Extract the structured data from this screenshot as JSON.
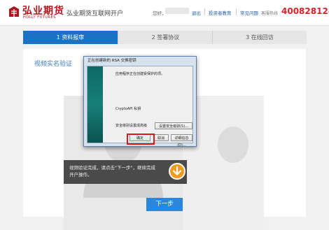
{
  "header": {
    "logo_cn": "弘业期货",
    "logo_en": "HOLLY FUTURES",
    "site_title": "弘业期货互联网开户",
    "greeting": "您好，",
    "logout": "退出",
    "links": [
      "投资者教育",
      "常见问题"
    ],
    "hotline_label": "客服热线",
    "hotline": "4008281288"
  },
  "steps": [
    {
      "label": "1 资料报审",
      "active": true
    },
    {
      "label": "2 签署协议",
      "active": false
    },
    {
      "label": "3 在线回访",
      "active": false
    }
  ],
  "panel": {
    "section_title": "视频实名验证",
    "video_hint": "视频验证完成，请点击\"下一步\"，继续完成开户操作。",
    "next_button": "下一步"
  },
  "dialog": {
    "title": "正在创建新的 RSA 交换密钥",
    "message": "应用程序正在创建受保护的项。",
    "key_name": "CryptoAPI 私钥",
    "security_level_label": "安全级别设置成高级",
    "set_security_button": "设置安全级别(S)...",
    "ok_button": "确定",
    "cancel_button": "取消",
    "details_button": "详细信息(D)..."
  },
  "colors": {
    "brand_red": "#b3141c",
    "hotline_red": "#d6232a",
    "active_step_blue": "#1a72c4",
    "highlight_red": "#e0141c",
    "play_orange": "#f29a1f"
  }
}
